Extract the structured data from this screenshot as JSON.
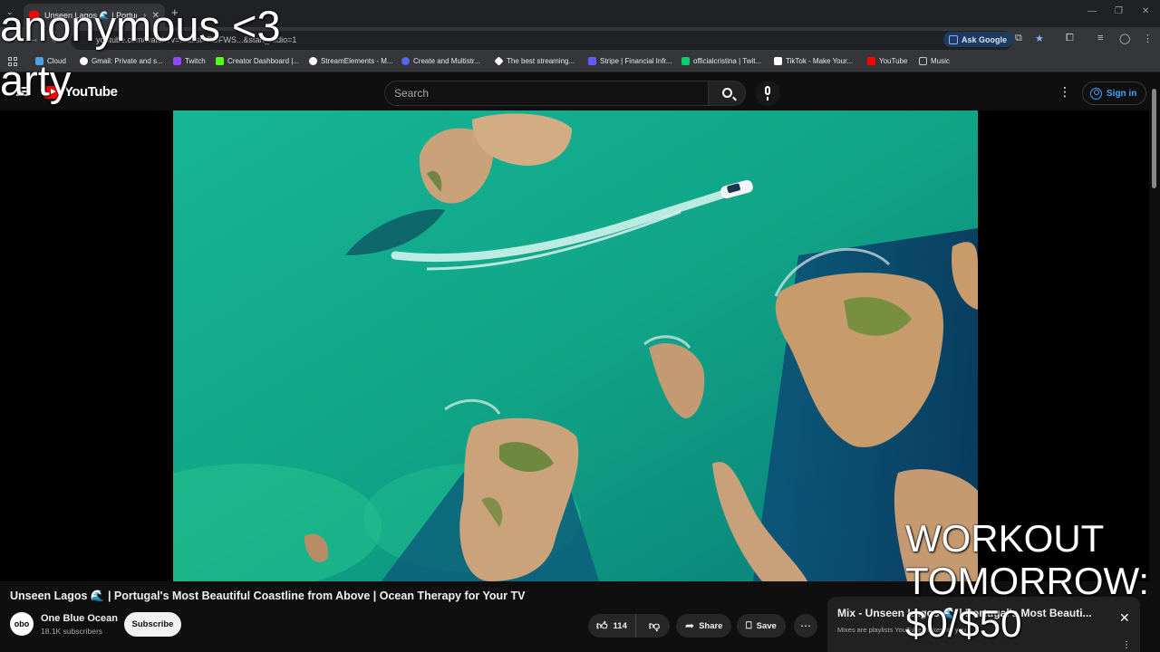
{
  "browser": {
    "tab_title": "Unseen Lagos 🌊 | Portuga",
    "url": "youtube.com/watch?v=...&list=RDFWS...&start_radio=1",
    "ask_google_label": "Ask Google",
    "bookmarks": [
      {
        "label": "Cloud",
        "icon": "cloud-icon",
        "color": "#4aa3df"
      },
      {
        "label": "Gmail: Private and s...",
        "icon": "google-icon",
        "color": "#ffffff"
      },
      {
        "label": "Twitch",
        "icon": "twitch-icon",
        "color": "#9146ff"
      },
      {
        "label": "Creator Dashboard |...",
        "icon": "kick-icon",
        "color": "#53fc18"
      },
      {
        "label": "StreamElements - M...",
        "icon": "streamelements-icon",
        "color": "#ffffff"
      },
      {
        "label": "Create and Multistr...",
        "icon": "restream-icon",
        "color": "#5865f2"
      },
      {
        "label": "The best streaming...",
        "icon": "diamond-icon",
        "color": "#ffffff"
      },
      {
        "label": "Stripe | Financial Infr...",
        "icon": "stripe-icon",
        "color": "#635bff"
      },
      {
        "label": "officialcristina | Twit...",
        "icon": "twitch-green-icon",
        "color": "#00d26a"
      },
      {
        "label": "TikTok - Make Your...",
        "icon": "tiktok-icon",
        "color": "#ffffff"
      },
      {
        "label": "YouTube",
        "icon": "youtube-icon",
        "color": "#ff0000"
      },
      {
        "label": "Music",
        "icon": "folder-icon",
        "color": "#c4c7c5"
      }
    ]
  },
  "youtube": {
    "logo_text": "YouTube",
    "search_placeholder": "Search",
    "sign_in_label": "Sign in"
  },
  "video": {
    "title": "Unseen Lagos 🌊 | Portugal's Most Beautiful Coastline from Above | Ocean Therapy for Your TV",
    "channel_name": "One Blue Ocean",
    "channel_avatar_text": "obo",
    "subscribers": "18.1K subscribers",
    "subscribe_label": "Subscribe",
    "likes": "114",
    "share_label": "Share",
    "save_label": "Save"
  },
  "mix": {
    "title": "Mix - Unseen Lagos 🌊 | Portugal's Most Beauti...",
    "subtitle": "Mixes are playlists YouTube makes for you"
  },
  "overlays": {
    "line1": "anonymous <3",
    "line2": "arty",
    "goal": "WORKOUT TOMORROW: $0/$50"
  },
  "colors": {
    "accent_blue": "#3ea6ff",
    "youtube_red": "#ff0000",
    "background": "#0f0f0f"
  }
}
